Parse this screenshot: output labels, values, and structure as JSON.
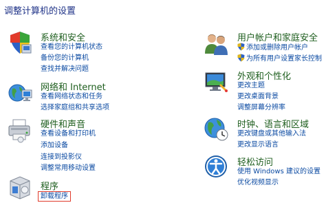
{
  "page": {
    "title": "调整计算机的设置"
  },
  "left": [
    {
      "name": "system-and-security",
      "icon": "shield-icon",
      "title": "系统和安全",
      "links": [
        "查看您的计算机状态",
        "备份您的计算机",
        "查找并解决问题"
      ]
    },
    {
      "name": "network-and-internet",
      "icon": "network-globe-icon",
      "title": "网络和 Internet",
      "links": [
        "查看网络状态和任务",
        "选择家庭组和共享选项"
      ]
    },
    {
      "name": "hardware-and-sound",
      "icon": "printer-icon",
      "title": "硬件和声音",
      "links": [
        "查看设备和打印机",
        "添加设备",
        "连接到投影仪",
        "调整常用移动设置"
      ]
    },
    {
      "name": "programs",
      "icon": "programs-box-icon",
      "title": "程序",
      "links": [
        "卸载程序"
      ]
    }
  ],
  "right": [
    {
      "name": "user-accounts",
      "icon": "users-icon",
      "title": "用户帐户和家庭安全",
      "links": [
        "添加或删除用户帐户",
        "为所有用户设置家长控制"
      ]
    },
    {
      "name": "appearance",
      "icon": "monitor-paint-icon",
      "title": "外观和个性化",
      "links": [
        "更改主题",
        "更改桌面背景",
        "调整屏幕分辨率"
      ]
    },
    {
      "name": "clock-language-region",
      "icon": "globe-clock-icon",
      "title": "时钟、语言和区域",
      "links": [
        "更改键盘或其他输入法",
        "更改显示语言"
      ]
    },
    {
      "name": "ease-of-access",
      "icon": "ease-of-access-icon",
      "title": "轻松访问",
      "links": [
        "使用 Windows 建议的设置",
        "优化视频显示"
      ]
    }
  ],
  "colors": {
    "title": "#1e3287",
    "category": "#1e5e1e",
    "link": "#0b4aa2",
    "highlight": "#e03a2a"
  }
}
